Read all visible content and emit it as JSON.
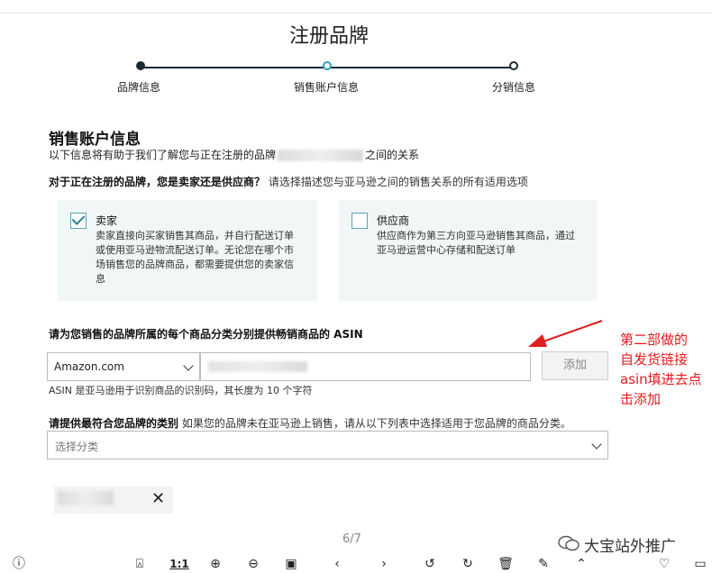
{
  "page": {
    "title": "注册品牌"
  },
  "steps": [
    {
      "label": "品牌信息",
      "state": "done"
    },
    {
      "label": "销售账户信息",
      "state": "current"
    },
    {
      "label": "分销信息",
      "state": "todo"
    }
  ],
  "section": {
    "title": "销售账户信息",
    "subtitle_prefix": "以下信息将有助于我们了解您与正在注册的品牌",
    "subtitle_suffix": "之间的关系"
  },
  "question": {
    "bold": "对于正在注册的品牌，您是卖家还是供应商？",
    "rest": "请选择描述您与亚马逊之间的销售关系的所有适用选项"
  },
  "options": [
    {
      "title": "卖家",
      "checked": true,
      "desc_lines": [
        "卖家直接向买家销售其商品，并自行配送订单",
        "或使用亚马逊物流配送订单。无论您在哪个市",
        "场销售您的品牌商品，都需要提供您的卖家信",
        "息"
      ]
    },
    {
      "title": "供应商",
      "checked": false,
      "desc_lines": [
        "供应商作为第三方向亚马逊销售其商品，通过",
        "亚马逊运营中心存储和配送订单"
      ]
    }
  ],
  "asin": {
    "label": "请为您销售的品牌所属的每个商品分类分别提供畅销商品的 ASIN",
    "marketplace": "Amazon.com",
    "add_button": "添加",
    "help": "ASIN 是亚马逊用于识别商品的识别码，其长度为 10 个字符"
  },
  "category": {
    "label_bold": "请提供最符合您品牌的类别",
    "label_rest": "如果您的品牌未在亚马逊上销售，请从以下列表中选择适用于您品牌的商品分类。",
    "placeholder": "选择分类"
  },
  "chip": {
    "remove": "✕"
  },
  "annotation": {
    "lines": [
      "第二部做的",
      "自发货链接",
      "asin填进去点",
      "击添加"
    ],
    "color": "#e11d1d"
  },
  "viewer": {
    "page_indicator": "6/7",
    "watermark": "大宝站外推广",
    "zoom_label": "1:1"
  },
  "colors": {
    "accent": "#2e7f95",
    "card_bg": "#f1f6f7",
    "step_dark": "#1b2b36"
  }
}
